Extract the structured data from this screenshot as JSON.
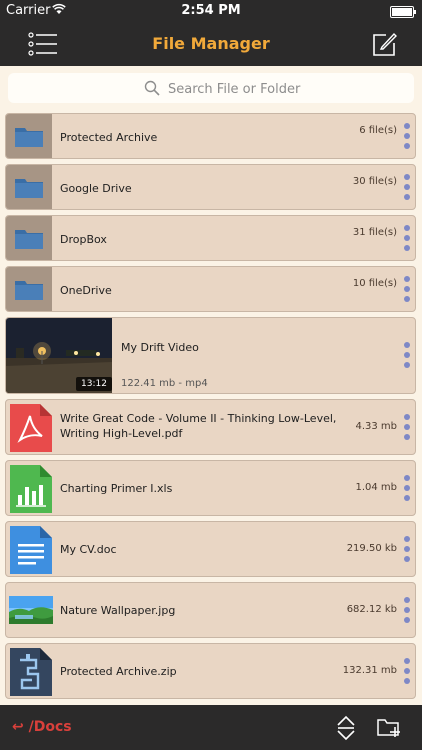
{
  "status": {
    "carrier": "Carrier",
    "time": "2:54 PM"
  },
  "nav": {
    "title": "File Manager"
  },
  "search": {
    "placeholder": "Search File or Folder"
  },
  "items": [
    {
      "name": "Protected Archive",
      "size": "6 file(s)",
      "type": "folder"
    },
    {
      "name": "Google Drive",
      "size": "30 file(s)",
      "type": "folder"
    },
    {
      "name": "DropBox",
      "size": "31 file(s)",
      "type": "folder"
    },
    {
      "name": "OneDrive",
      "size": "10 file(s)",
      "type": "folder"
    },
    {
      "name": "My Drift Video",
      "duration": "13:12",
      "sub": "122.41 mb - mp4",
      "type": "video"
    },
    {
      "name": "Write Great Code - Volume II - Thinking Low-Level, Writing High-Level.pdf",
      "size": "4.33 mb",
      "type": "pdf"
    },
    {
      "name": "Charting Primer I.xls",
      "size": "1.04 mb",
      "type": "xls"
    },
    {
      "name": "My CV.doc",
      "size": "219.50 kb",
      "type": "doc"
    },
    {
      "name": "Nature Wallpaper.jpg",
      "size": "682.12 kb",
      "type": "jpg"
    },
    {
      "name": "Protected Archive.zip",
      "size": "132.31 mb",
      "type": "zip"
    }
  ],
  "bottom": {
    "path": "↩ /Docs"
  },
  "colors": {
    "accent": "#f1a93a",
    "bar": "#2b2a2a",
    "row": "#e9d6c4",
    "path": "#d9403b",
    "dots": "#7e88c6"
  },
  "icons": {
    "menu": "list-menu-icon",
    "compose": "compose-icon",
    "search": "search-icon",
    "sort": "sort-icon",
    "new_folder": "new-folder-icon"
  }
}
